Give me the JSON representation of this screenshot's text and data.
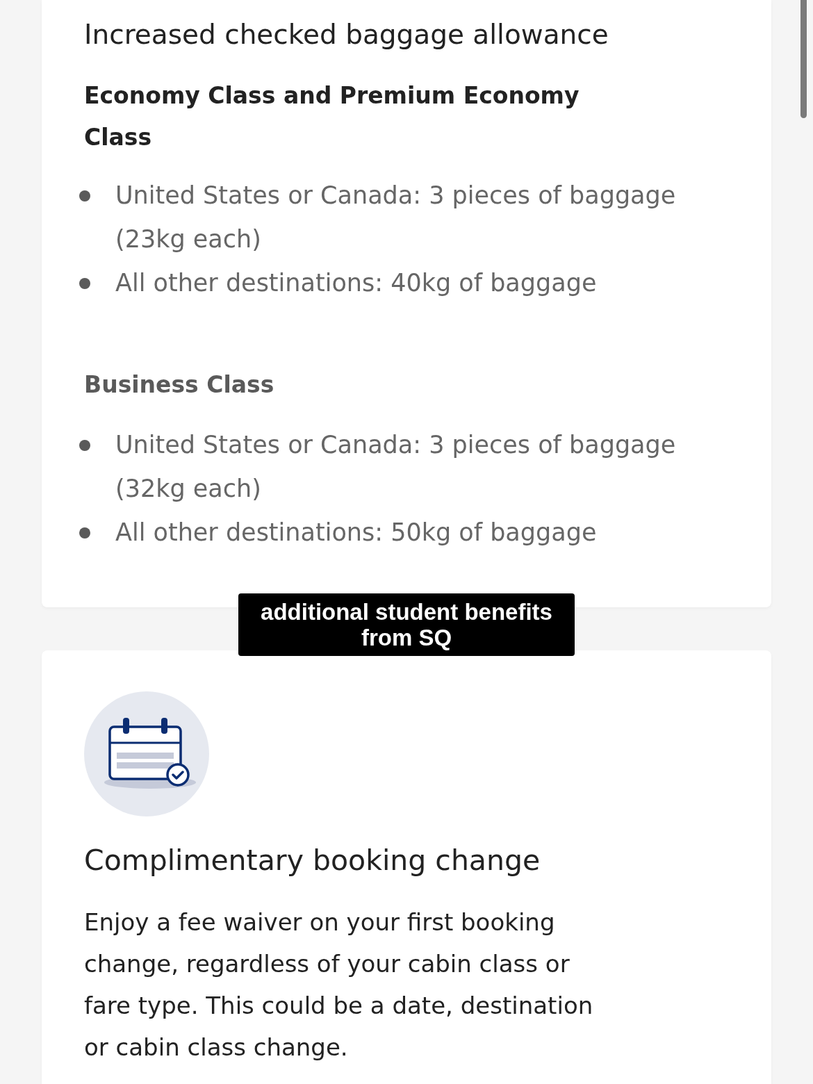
{
  "cards": [
    {
      "kind": "list",
      "title": "Increased checked baggage allowance",
      "groups": [
        {
          "heading": "Economy Class and Premium Economy Class",
          "muted": false,
          "items": [
            "United States or Canada: 3 pieces of baggage (23kg each)",
            "All other destinations: 40kg of baggage"
          ]
        },
        {
          "heading": "Business Class",
          "muted": true,
          "items": [
            "United States or Canada: 3 pieces of baggage (32kg each)",
            "All other destinations: 50kg of baggage"
          ]
        }
      ]
    },
    {
      "kind": "feature",
      "title": "Complimentary booking change",
      "body": "Enjoy a fee waiver on your first booking change, regardless of your cabin class or fare type. This could be a date, destination or cabin class change."
    }
  ],
  "caption": "additional student benefits from SQ"
}
